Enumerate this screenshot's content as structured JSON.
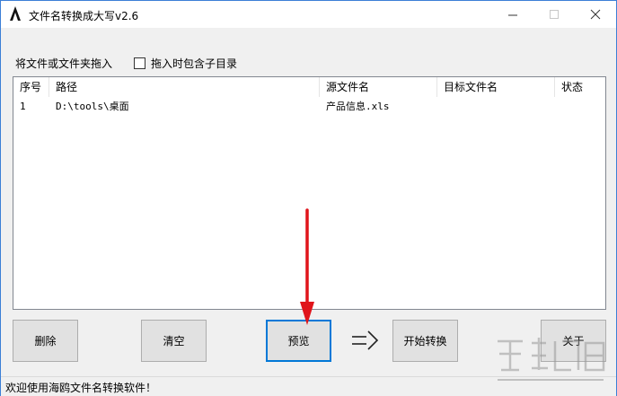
{
  "window": {
    "title": "文件名转换成大写v2.6",
    "minimize_icon": "minimize-icon",
    "maximize_icon": "maximize-icon",
    "close_icon": "close-icon"
  },
  "toolbar": {
    "drop_label": "将文件或文件夹拖入",
    "include_subdirs_label": "拖入时包含子目录",
    "include_subdirs_checked": false
  },
  "list": {
    "columns": [
      "序号",
      "路径",
      "源文件名",
      "目标文件名",
      "状态"
    ],
    "rows": [
      {
        "index": "1",
        "path": "D:\\tools\\桌面",
        "source_name": "产品信息.xls",
        "target_name": "",
        "status": ""
      }
    ]
  },
  "buttons": {
    "delete": "删除",
    "clear": "清空",
    "preview": "预览",
    "arrow": "=>",
    "start_convert": "开始转换",
    "about": "关于"
  },
  "status": {
    "message": "欢迎使用海鸥文件名转换软件！"
  },
  "colors": {
    "accent_border": "#0078d7",
    "annotation_arrow": "#e0151b"
  }
}
